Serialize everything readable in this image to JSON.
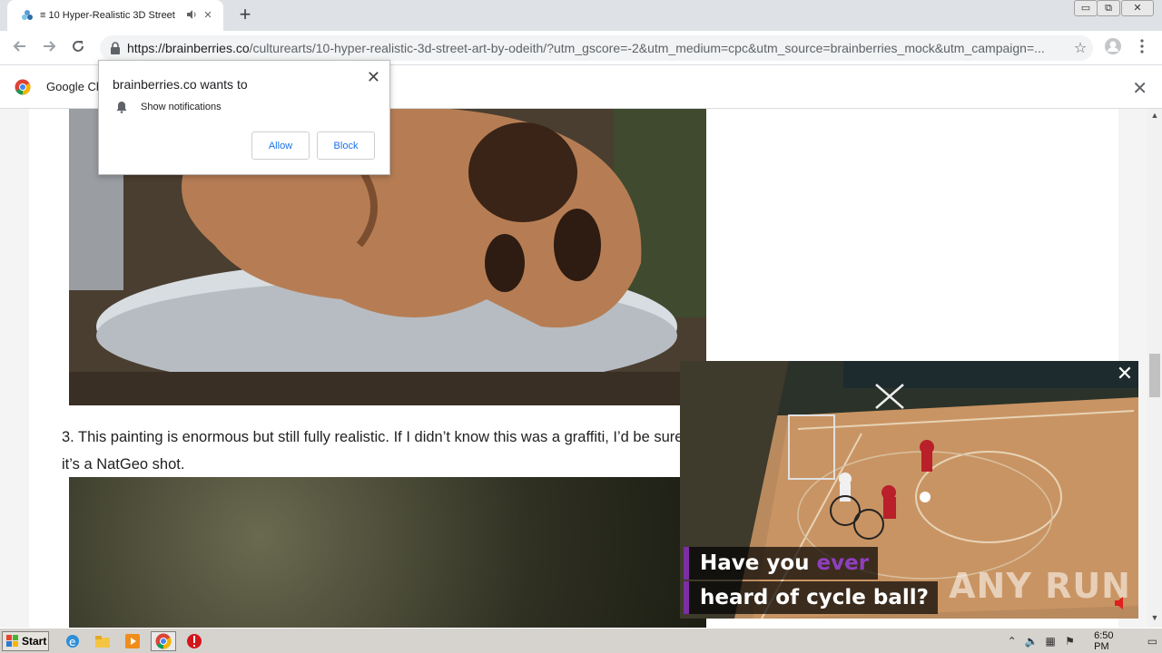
{
  "tab": {
    "title": "≡ 10 Hyper-Realistic 3D Street",
    "audio_icon": "speaker-icon",
    "close_label": "×",
    "new_tab_label": "+"
  },
  "window_controls": {
    "minimize": "▭",
    "restore": "⧉",
    "close": "✕"
  },
  "toolbar": {
    "url_host": "https://brainberries.co",
    "url_rest": "/culturearts/10-hyper-realistic-3d-street-art-by-odeith/?utm_gscore=-2&utm_medium=cpc&utm_source=brainberries_mock&utm_campaign=...",
    "star": "☆"
  },
  "infobar": {
    "text": "Google Ch",
    "close": "✕"
  },
  "permission": {
    "heading": "brainberries.co wants to",
    "row": "Show notifications",
    "allow": "Allow",
    "block": "Block",
    "close": "✕"
  },
  "article": {
    "paragraph": "3. This painting is enormous but still fully realistic. If I didn’t know this was a graffiti, I’d be sure it’s a NatGeo shot."
  },
  "video": {
    "caption1_a": "Have you ",
    "caption1_b": "ever",
    "caption2": "heard of cycle ball?",
    "close": "✕",
    "watermark": "ANY RUN"
  },
  "taskbar": {
    "start": "Start",
    "clock": "6:50 PM"
  },
  "colors": {
    "accent": "#1a73e8",
    "caption_purple": "#8e3fbe",
    "tab_strip": "#dee1e6"
  }
}
